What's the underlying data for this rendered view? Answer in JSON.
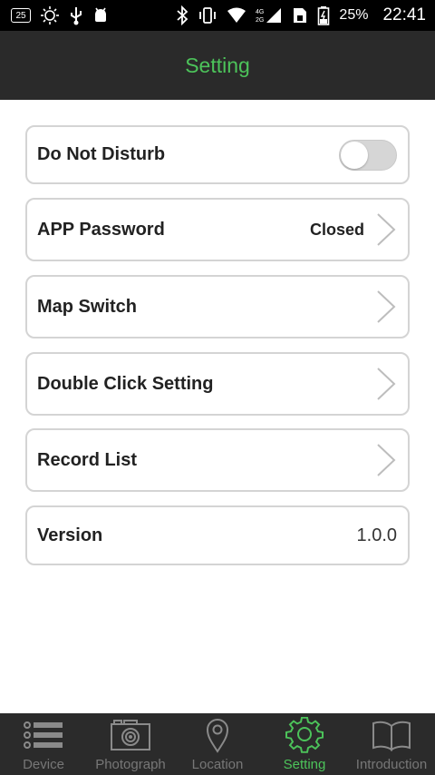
{
  "status_bar": {
    "notification_count": "25",
    "network": "4G 2G",
    "battery": "25%",
    "time": "22:41"
  },
  "header": {
    "title": "Setting"
  },
  "settings": [
    {
      "label": "Do Not Disturb",
      "control": "toggle",
      "toggle_on": false
    },
    {
      "label": "APP Password",
      "value": "Closed",
      "control": "chevron"
    },
    {
      "label": "Map Switch",
      "control": "chevron"
    },
    {
      "label": "Double Click Setting",
      "control": "chevron"
    },
    {
      "label": "Record List",
      "control": "chevron"
    },
    {
      "label": "Version",
      "value": "1.0.0",
      "control": "none"
    }
  ],
  "bottom_nav": {
    "active": "Setting",
    "items": [
      {
        "label": "Device",
        "icon": "list-icon"
      },
      {
        "label": "Photograph",
        "icon": "camera-icon"
      },
      {
        "label": "Location",
        "icon": "location-pin-icon"
      },
      {
        "label": "Setting",
        "icon": "gear-icon"
      },
      {
        "label": "Introduction",
        "icon": "book-icon"
      }
    ]
  },
  "colors": {
    "accent": "#4cc35a",
    "header_bg": "#2a2a2a",
    "nav_bg": "#2b2b2b",
    "nav_inactive": "#777777",
    "row_border": "#d4d4d4"
  }
}
